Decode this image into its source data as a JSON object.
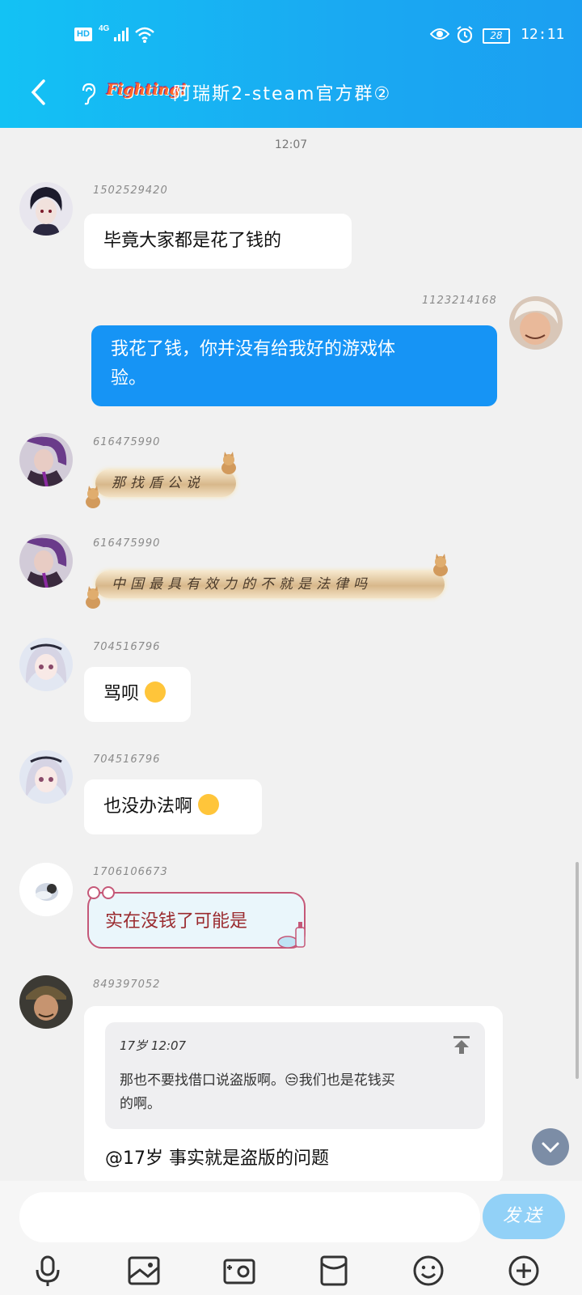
{
  "status": {
    "hd": "HD",
    "network": "4G",
    "battery": "28",
    "time": "12:11"
  },
  "chat": {
    "brand": "Fighting!",
    "title": "阿瑞斯2-steam官方群②",
    "timestamp": "12:07"
  },
  "messages": [
    {
      "id": "1502529420",
      "text": "毕竟大家都是花了钱的"
    },
    {
      "id": "1123214168",
      "text_line1": "我花了钱，你并没有给我好的游戏体",
      "text_line2": "验。"
    },
    {
      "id": "616475990",
      "text": "那找盾公说"
    },
    {
      "id": "616475990",
      "text": "中国最具有效力的不就是法律吗"
    },
    {
      "id": "704516796",
      "text": "骂呗"
    },
    {
      "id": "704516796",
      "text": "也没办法啊"
    },
    {
      "id": "1706106673",
      "text": "实在没钱了可能是"
    },
    {
      "id": "849397052",
      "quote_header": "17岁 12:07",
      "quote_line1": "那也不要找借口说盗版啊。😒我们也是花钱买",
      "quote_line2": "的啊。",
      "reply": "@17岁 事实就是盗版的问题"
    }
  ],
  "input": {
    "placeholder": "",
    "send_label": "发送"
  },
  "colors": {
    "header": "#16b1f2",
    "my_bubble": "#1694f5",
    "send_button": "#92d1f7"
  }
}
